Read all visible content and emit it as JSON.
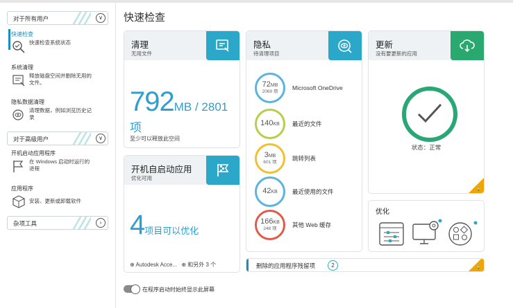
{
  "sidebar": {
    "group1": "对于所有用户",
    "group2": "对于高级用户",
    "group3": "杂项工具",
    "items": [
      {
        "title": "快速检查",
        "desc": "快速检查系统状态"
      },
      {
        "title": "系统清理",
        "desc": "释放磁盘空间并删除无用的文件。"
      },
      {
        "title": "隐私数据清理",
        "desc": "清理数据，例如浏览历史记录"
      },
      {
        "title": "开机启动应用程序",
        "desc": "在 Windows 启动时运行的进程"
      },
      {
        "title": "应用程序",
        "desc": "安装、更新或卸载软件"
      }
    ]
  },
  "page_title": "快速检查",
  "clean": {
    "title": "清理",
    "subtitle": "无用文件",
    "amount": "792",
    "unit": "MB / 2801 项",
    "footer": "至少可以释放此空间"
  },
  "startup": {
    "title": "开机自启动应用",
    "subtitle": "优化可用",
    "amount": "4",
    "unit": "项目可以优化",
    "footer_app": "Autodesk Acce...",
    "footer_more": "和另外 3 个"
  },
  "privacy": {
    "title": "隐私",
    "subtitle": "待清理项目",
    "items": [
      {
        "value": "72",
        "unit": "MB",
        "sub": "2069 项",
        "label": "Microsoft OneDrive",
        "color": "#5bb3e0"
      },
      {
        "value": "140",
        "unit": "KB",
        "sub": "",
        "label": "最近的文件",
        "color": "#b5cf4a"
      },
      {
        "value": "3",
        "unit": "MB",
        "sub": "601 项",
        "label": "跳转列表",
        "color": "#f0c030"
      },
      {
        "value": "42",
        "unit": "KB",
        "sub": "",
        "label": "最近使用的文件",
        "color": "#5bb3e0"
      },
      {
        "value": "166",
        "unit": "KB",
        "sub": "248 项",
        "label": "其他 Web 缓存",
        "color": "#e05a4a"
      }
    ]
  },
  "update": {
    "title": "更新",
    "subtitle": "没有要更新的应用",
    "status": "状态：正常"
  },
  "optimize": {
    "title": "优化"
  },
  "removed": {
    "label": "删除的应用程序残留项",
    "count": "2"
  },
  "toggle_label": "在程序启动时始终显示此屏幕",
  "colors": {
    "accent_blue": "#2aa7c9",
    "accent_green": "#29a86f",
    "lock_orange": "#f0a500"
  }
}
